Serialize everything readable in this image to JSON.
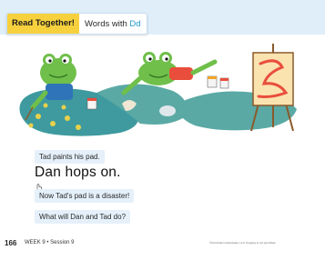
{
  "header": {
    "badge": "Read Together!",
    "title_prefix": "Words with ",
    "title_letters": "Dd"
  },
  "illustration": {
    "description_icons": [
      "frog-painting-icon",
      "frog-hopping-icon",
      "lily-pad-icon",
      "paint-can-icon",
      "easel-icon"
    ]
  },
  "story": {
    "line1": "Tad paints his pad.",
    "line2": "Dan hops on.",
    "line3": "Now Tad's pad is a disaster!",
    "line4": "What will Dan and Tad do?"
  },
  "footer": {
    "page_number": "166",
    "week_session": "WEEK 9 • Session 9",
    "copyright": "©Curriculum Associates, LLC  Copying is not permitted."
  },
  "colors": {
    "badge": "#f7d13d",
    "accent": "#1e9ad6",
    "band": "#dfeef9",
    "text_box": "#e5f0fa"
  }
}
